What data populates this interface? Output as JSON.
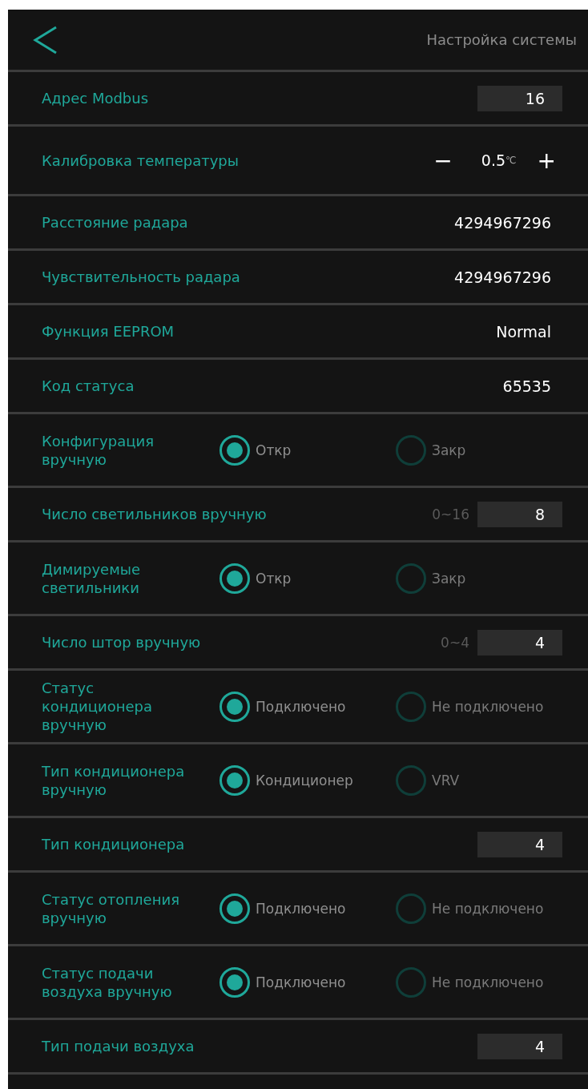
{
  "header": {
    "title": "Настройка системы"
  },
  "rows": [
    {
      "kind": "input",
      "label": "Адрес Modbus",
      "value": "16"
    },
    {
      "kind": "stepper",
      "label": "Калибровка температуры",
      "minus": "−",
      "value": "0.5",
      "unit": "℃",
      "plus": "+"
    },
    {
      "kind": "value",
      "label": "Расстояние радара",
      "value": "4294967296"
    },
    {
      "kind": "value",
      "label": "Чувствительность радара",
      "value": "4294967296"
    },
    {
      "kind": "value",
      "label": "Функция EEPROM",
      "value": "Normal"
    },
    {
      "kind": "value",
      "label": "Код статуса",
      "value": "65535"
    },
    {
      "kind": "radio",
      "label": "Конфигурация вручную",
      "options": [
        {
          "label": "Откр",
          "selected": true
        },
        {
          "label": "Закр",
          "selected": false
        }
      ]
    },
    {
      "kind": "input",
      "label": "Число светильников вручную",
      "hint": "0~16",
      "value": "8"
    },
    {
      "kind": "radio",
      "label": "Димируемые светильники",
      "options": [
        {
          "label": "Откр",
          "selected": true
        },
        {
          "label": "Закр",
          "selected": false
        }
      ]
    },
    {
      "kind": "input",
      "label": "Число штор вручную",
      "hint": "0~4",
      "value": "4"
    },
    {
      "kind": "radio",
      "label": "Статус кондиционера вручную",
      "options": [
        {
          "label": "Подключено",
          "selected": true
        },
        {
          "label": "Не подключено",
          "selected": false
        }
      ]
    },
    {
      "kind": "radio",
      "label": "Тип кондиционера вручную",
      "options": [
        {
          "label": "Кондиционер",
          "selected": true
        },
        {
          "label": "VRV",
          "selected": false
        }
      ]
    },
    {
      "kind": "input",
      "label": "Тип кондиционера",
      "value": "4"
    },
    {
      "kind": "radio",
      "label": "Статус отопления вручную",
      "options": [
        {
          "label": "Подключено",
          "selected": true
        },
        {
          "label": "Не подключено",
          "selected": false
        }
      ]
    },
    {
      "kind": "radio",
      "label": "Статус подачи воздуха вручную",
      "options": [
        {
          "label": "Подключено",
          "selected": true
        },
        {
          "label": "Не подключено",
          "selected": false
        }
      ]
    },
    {
      "kind": "input",
      "label": "Тип подачи воздуха",
      "value": "4"
    }
  ]
}
